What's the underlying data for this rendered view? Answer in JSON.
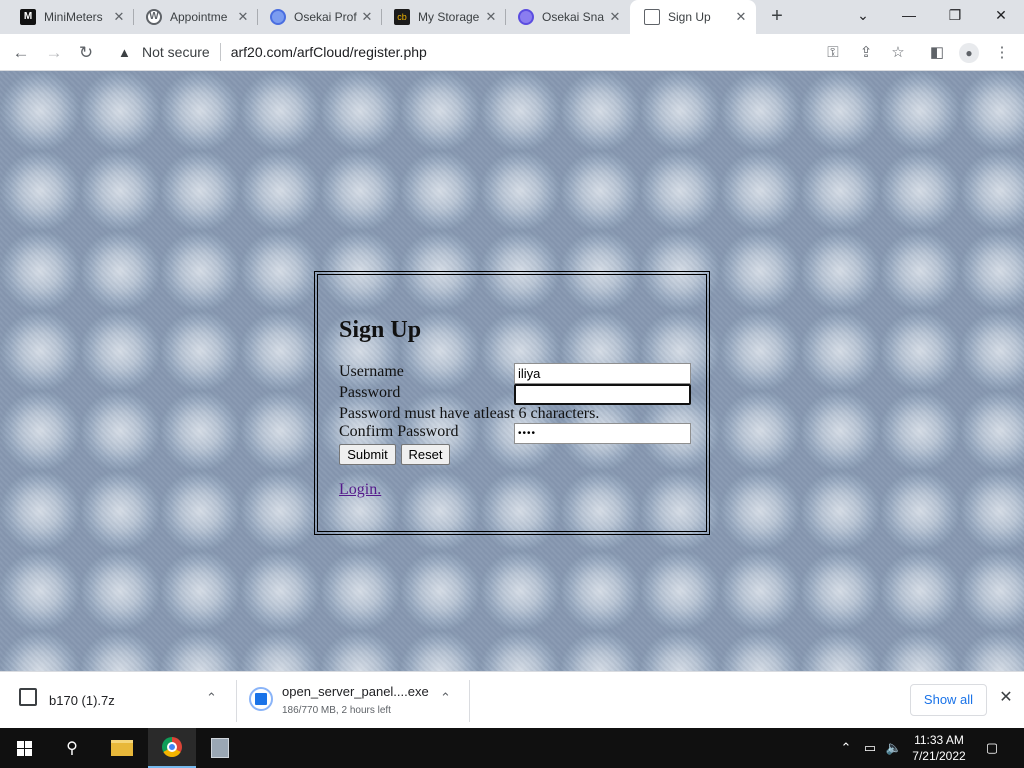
{
  "browser": {
    "tabs": [
      {
        "title": "MiniMeters",
        "favicon": "minimeters-icon",
        "color": "#111111",
        "active": false
      },
      {
        "title": "Appointme",
        "favicon": "wordpress-icon",
        "color": "#3c4043",
        "active": false
      },
      {
        "title": "Osekai Prof",
        "favicon": "osekai-icon",
        "color": "#4a6ee0",
        "active": false
      },
      {
        "title": "My Storage",
        "favicon": "storage-icon",
        "color": "#1b1b1b",
        "active": false
      },
      {
        "title": "Osekai Sna",
        "favicon": "osekai-icon",
        "color": "#5b4de0",
        "active": false
      },
      {
        "title": "Sign Up",
        "favicon": "page-icon",
        "color": "#5f6368",
        "active": true
      }
    ],
    "toolbar": {
      "security_label": "Not secure",
      "url": "arf20.com/arfCloud/register.php"
    }
  },
  "form": {
    "heading": "Sign Up",
    "username_label": "Username",
    "username_value": "iliya",
    "password_label": "Password",
    "password_value": "",
    "password_hint": "Password must have atleast 6 characters.",
    "confirm_label": "Confirm Password",
    "confirm_value": "••••",
    "submit_label": "Submit",
    "reset_label": "Reset",
    "login_link": "Login."
  },
  "downloads": {
    "items": [
      {
        "name": "b170 (1).7z",
        "status": ""
      },
      {
        "name": "open_server_panel....exe",
        "status": "186/770 MB, 2 hours left"
      }
    ],
    "show_all_label": "Show all"
  },
  "taskbar": {
    "time": "11:33 AM",
    "date": "7/21/2022"
  }
}
